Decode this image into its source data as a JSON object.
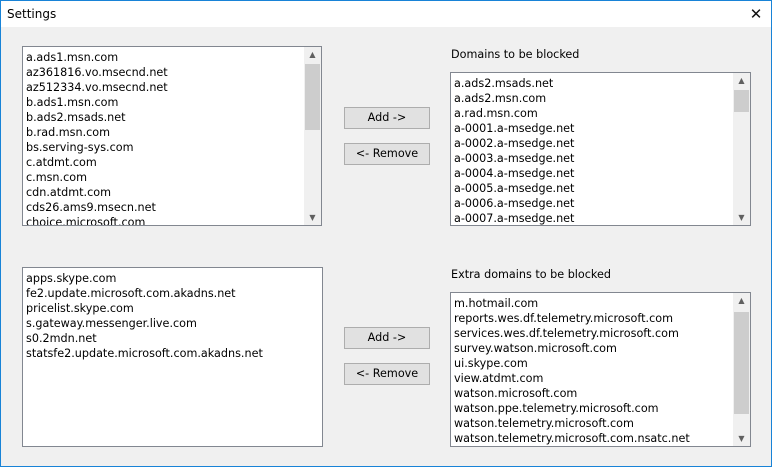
{
  "window": {
    "title": "Settings",
    "close_glyph": "✕"
  },
  "top": {
    "available": {
      "items": [
        "a.ads1.msn.com",
        "az361816.vo.msecnd.net",
        "az512334.vo.msecnd.net",
        "b.ads1.msn.com",
        "b.ads2.msads.net",
        "b.rad.msn.com",
        "bs.serving-sys.com",
        "c.atdmt.com",
        "c.msn.com",
        "cdn.atdmt.com",
        "cds26.ams9.msecn.net",
        "choice.microsoft.com"
      ]
    },
    "add_label": "Add ->",
    "remove_label": "<- Remove",
    "blocked_label": "Domains to be blocked",
    "blocked": {
      "items": [
        "a.ads2.msads.net",
        "a.ads2.msn.com",
        "a.rad.msn.com",
        "a-0001.a-msedge.net",
        "a-0002.a-msedge.net",
        "a-0003.a-msedge.net",
        "a-0004.a-msedge.net",
        "a-0005.a-msedge.net",
        "a-0006.a-msedge.net",
        "a-0007.a-msedge.net"
      ]
    }
  },
  "bottom": {
    "available": {
      "items": [
        "apps.skype.com",
        "fe2.update.microsoft.com.akadns.net",
        "pricelist.skype.com",
        "s.gateway.messenger.live.com",
        "s0.2mdn.net",
        "statsfe2.update.microsoft.com.akadns.net"
      ]
    },
    "add_label": "Add ->",
    "remove_label": "<- Remove",
    "blocked_label": "Extra domains to be blocked",
    "blocked": {
      "items": [
        "m.hotmail.com",
        "reports.wes.df.telemetry.microsoft.com",
        "services.wes.df.telemetry.microsoft.com",
        "survey.watson.microsoft.com",
        "ui.skype.com",
        "view.atdmt.com",
        "watson.microsoft.com",
        "watson.ppe.telemetry.microsoft.com",
        "watson.telemetry.microsoft.com",
        "watson.telemetry.microsoft.com.nsatc.net"
      ]
    }
  },
  "scroll_glyphs": {
    "up": "▲",
    "down": "▼"
  }
}
